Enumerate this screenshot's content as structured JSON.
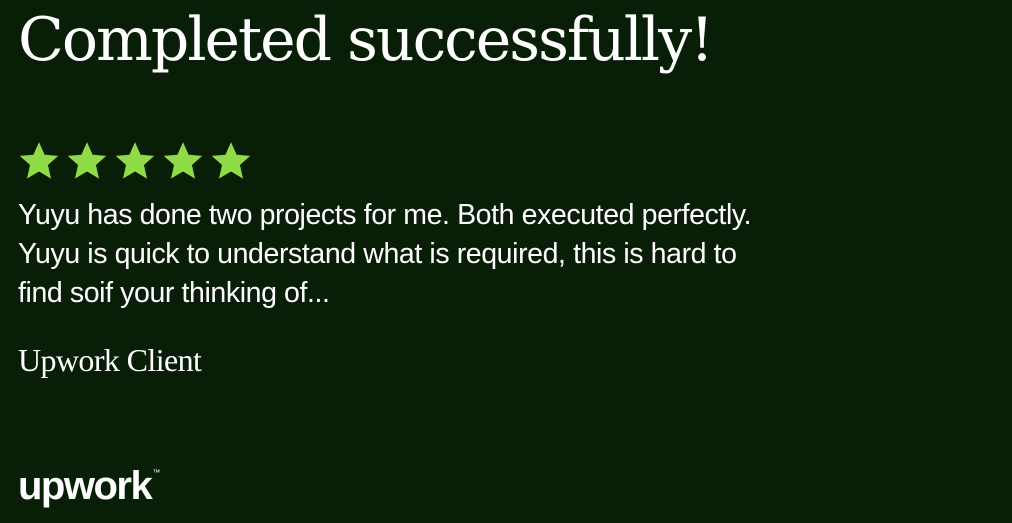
{
  "colors": {
    "background": "#081e07",
    "text": "#ffffff",
    "star": "#8fdc46"
  },
  "card": {
    "headline": "Completed successfully!",
    "rating": 5,
    "max_rating": 5,
    "star_icon": "star-icon",
    "review": "Yuyu has done two projects for me. Both executed perfectly. Yuyu is quick to understand what is required, this is hard to find soif your thinking of...",
    "author": "Upwork Client"
  },
  "brand": {
    "logo_text": "upwork",
    "trademark": "™"
  }
}
